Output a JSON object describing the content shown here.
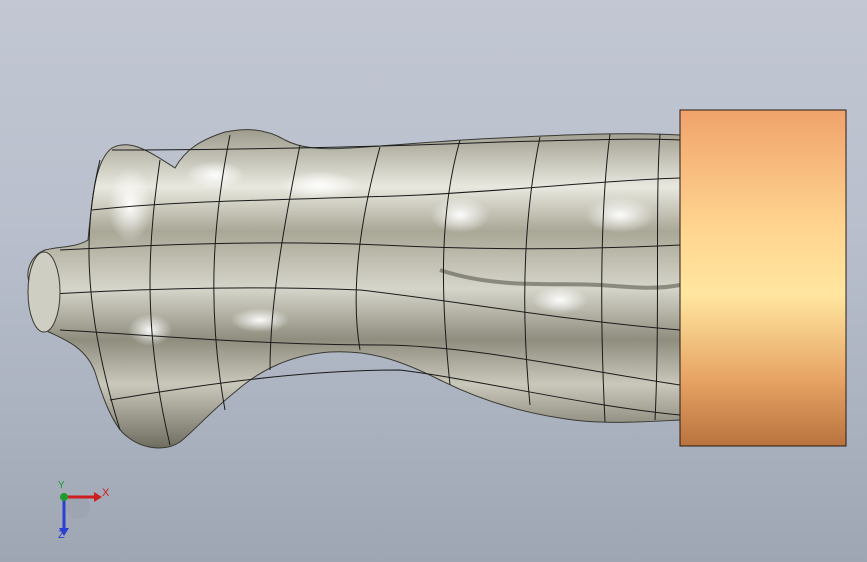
{
  "viewport": {
    "background_top": "#c2c7d3",
    "background_bottom": "#9ea5b3"
  },
  "model": {
    "surface_color": "#b7b5a6",
    "surface_highlight": "#ffffff",
    "isoparam_color": "#1a1a1a",
    "cylinder_color_light": "#ffe28f",
    "cylinder_color_dark": "#c7804a"
  },
  "triad": {
    "x_label": "X",
    "y_label": "Y",
    "z_label": "Z",
    "x_color": "#cc2020",
    "y_color": "#1f9b2f",
    "z_color": "#2b3fd0",
    "x_icon": "arrow-right-icon",
    "z_icon": "arrow-down-icon"
  }
}
